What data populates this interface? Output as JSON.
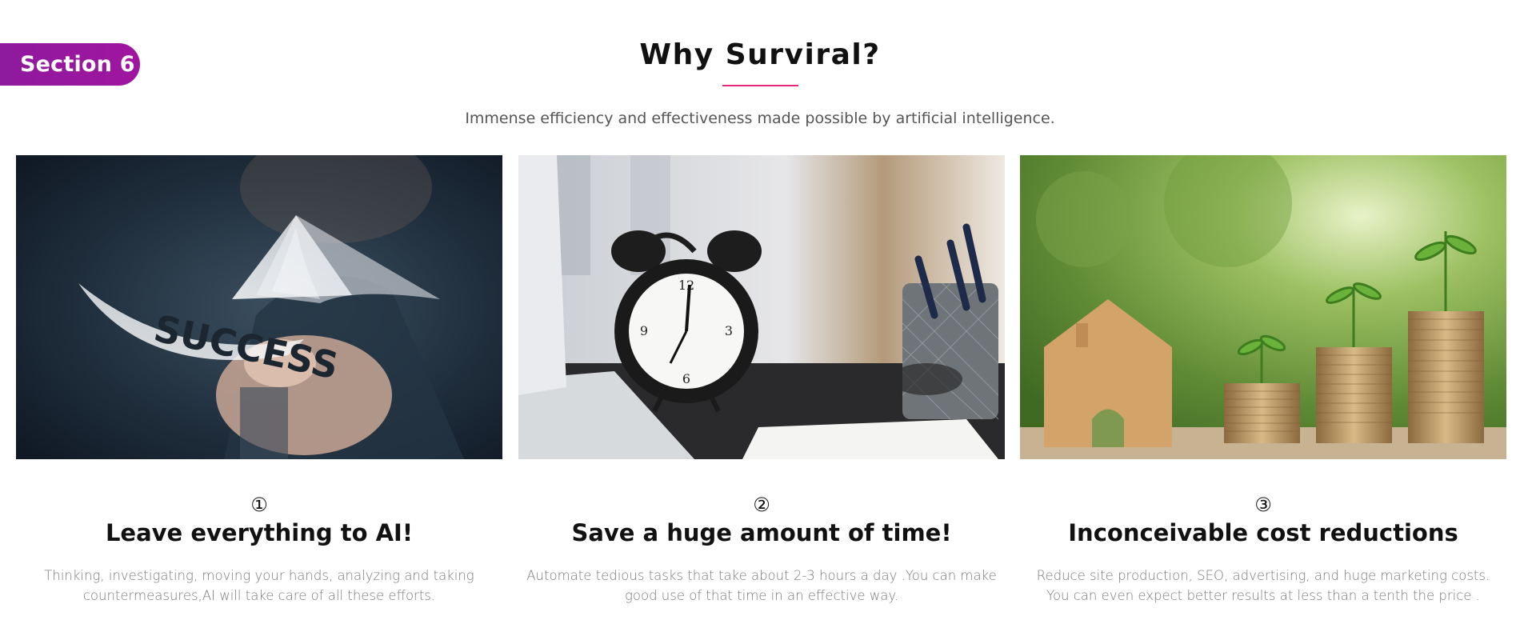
{
  "section_badge": "Section 6",
  "heading": "Why Surviral?",
  "subtitle": "Immense efficiency and effectiveness made possible by artificial intelligence.",
  "accent_color": "#e5287d",
  "badge_color": "#9b179f",
  "cards": [
    {
      "number": "①",
      "title": "Leave everything to AI!",
      "description": "Thinking, investigating, moving your hands, analyzing and taking countermeasures,AI will take care of all these efforts.",
      "image_text": "SUCCESS"
    },
    {
      "number": "②",
      "title": "Save a huge amount of time!",
      "description": "Automate tedious tasks that take about 2-3 hours a day .You can make good use of that time in an effective way."
    },
    {
      "number": "③",
      "title": "Inconceivable cost reductions",
      "description": "Reduce site production, SEO, advertising, and huge marketing costs. You can even expect better results at less than a tenth the price ."
    }
  ]
}
